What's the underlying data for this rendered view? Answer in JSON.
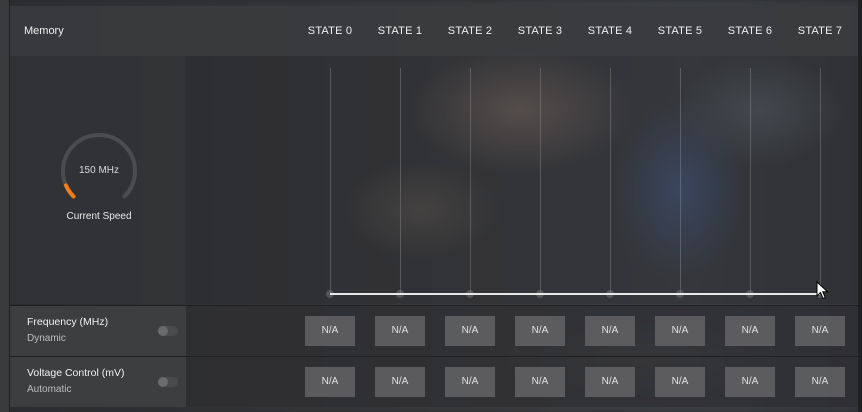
{
  "header": {
    "title": "Memory",
    "states": [
      "STATE 0",
      "STATE 1",
      "STATE 2",
      "STATE 3",
      "STATE 4",
      "STATE 5",
      "STATE 6",
      "STATE 7"
    ]
  },
  "gauge": {
    "value": "150 MHz",
    "caption": "Current Speed",
    "level": 0.08,
    "accent": "#f07d1a"
  },
  "rows": [
    {
      "title": "Frequency (MHz)",
      "subtitle": "Dynamic",
      "toggle_on": false,
      "values": [
        "N/A",
        "N/A",
        "N/A",
        "N/A",
        "N/A",
        "N/A",
        "N/A",
        "N/A"
      ]
    },
    {
      "title": "Voltage Control (mV)",
      "subtitle": "Automatic",
      "toggle_on": false,
      "values": [
        "N/A",
        "N/A",
        "N/A",
        "N/A",
        "N/A",
        "N/A",
        "N/A",
        "N/A"
      ]
    }
  ],
  "icons": {
    "cursor": "mouse-pointer-icon"
  }
}
